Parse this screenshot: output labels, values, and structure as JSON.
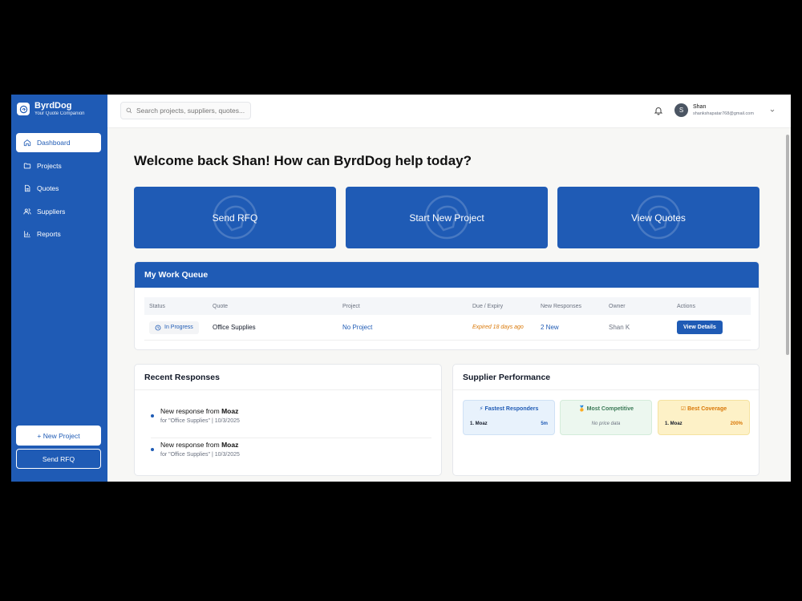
{
  "brand": {
    "name": "ByrdDog",
    "tagline": "Your Quote Companion"
  },
  "nav": [
    {
      "label": "Dashboard",
      "icon": "home-icon",
      "active": true
    },
    {
      "label": "Projects",
      "icon": "folder-icon"
    },
    {
      "label": "Quotes",
      "icon": "document-icon"
    },
    {
      "label": "Suppliers",
      "icon": "users-icon"
    },
    {
      "label": "Reports",
      "icon": "bar-chart-icon"
    }
  ],
  "sidebar_buttons": {
    "new_project": "+ New Project",
    "send_rfq": "Send RFQ"
  },
  "search": {
    "placeholder": "Search projects, suppliers, quotes..."
  },
  "user": {
    "initial": "S",
    "name": "Shan",
    "email": "shankshapatar768@gmail.com"
  },
  "welcome": "Welcome back Shan! How can ByrdDog help today?",
  "actions": [
    "Send RFQ",
    "Start New Project",
    "View Quotes"
  ],
  "work_queue": {
    "title": "My Work Queue",
    "columns": [
      "Status",
      "Quote",
      "Project",
      "Due / Expiry",
      "New Responses",
      "Owner",
      "Actions"
    ],
    "rows": [
      {
        "status": "In Progress",
        "quote": "Office Supplies",
        "project": "No Project",
        "due": "Expired 18 days ago",
        "new_responses": "2 New",
        "owner": "Shan K",
        "action": "View Details"
      }
    ]
  },
  "recent_responses": {
    "title": "Recent Responses",
    "items": [
      {
        "prefix": "New response from ",
        "supplier": "Moaz",
        "detail": "for \"Office Supplies\" | 10/3/2025"
      },
      {
        "prefix": "New response from ",
        "supplier": "Moaz",
        "detail": "for \"Office Supplies\" | 10/3/2025"
      }
    ]
  },
  "supplier_performance": {
    "title": "Supplier Performance",
    "cards": [
      {
        "title": "Fastest Responders",
        "icon": "lightning-icon",
        "rank": "1. Moaz",
        "value": "5m",
        "bg": "#e8f2fc",
        "color": "#1f5bb5"
      },
      {
        "title": "Most Competitive",
        "icon": "medal-icon",
        "note": "No price data",
        "bg": "#ecf7ef",
        "color": "#3b7a57"
      },
      {
        "title": "Best Coverage",
        "icon": "checkbox-icon",
        "rank": "1. Moaz",
        "value": "200%",
        "bg": "#fdf1c7",
        "color": "#d97706"
      }
    ]
  },
  "colors": {
    "brand": "#1f5bb5",
    "warning": "#d97706"
  }
}
